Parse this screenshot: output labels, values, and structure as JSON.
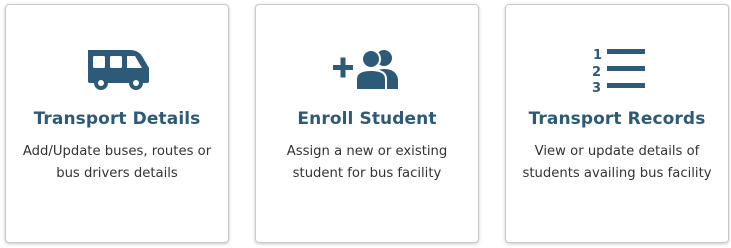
{
  "colors": {
    "accent": "#2d5a78",
    "text": "#333333",
    "border": "#c9c9c9"
  },
  "cards": [
    {
      "icon": "bus-icon",
      "title": "Transport Details",
      "description": "Add/Update buses, routes or bus drivers details"
    },
    {
      "icon": "add-users-icon",
      "title": "Enroll Student",
      "description": "Assign a new or existing student for bus facility"
    },
    {
      "icon": "numbered-list-icon",
      "title": "Transport Records",
      "description": "View or update details of students availing bus facility"
    }
  ]
}
